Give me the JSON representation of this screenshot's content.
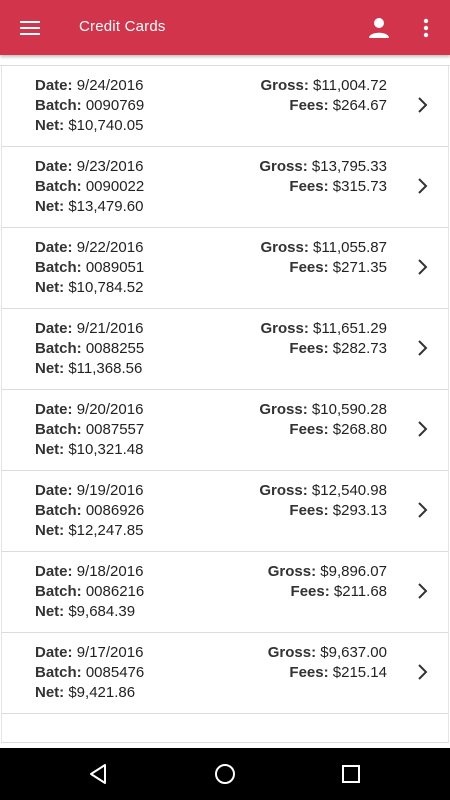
{
  "app_bar": {
    "title": "Credit Cards",
    "menu_icon": "hamburger-menu-icon",
    "account_icon": "account-icon",
    "more_icon": "more-vert-icon",
    "color": "#d2344b"
  },
  "labels": {
    "date": "Date:",
    "batch": "Batch:",
    "net": "Net:",
    "gross": "Gross:",
    "fees": "Fees:"
  },
  "batches": [
    {
      "date": "9/24/2016",
      "batch": "0090769",
      "net": "$10,740.05",
      "gross": "$11,004.72",
      "fees": "$264.67"
    },
    {
      "date": "9/23/2016",
      "batch": "0090022",
      "net": "$13,479.60",
      "gross": "$13,795.33",
      "fees": "$315.73"
    },
    {
      "date": "9/22/2016",
      "batch": "0089051",
      "net": "$10,784.52",
      "gross": "$11,055.87",
      "fees": "$271.35"
    },
    {
      "date": "9/21/2016",
      "batch": "0088255",
      "net": "$11,368.56",
      "gross": "$11,651.29",
      "fees": "$282.73"
    },
    {
      "date": "9/20/2016",
      "batch": "0087557",
      "net": "$10,321.48",
      "gross": "$10,590.28",
      "fees": "$268.80"
    },
    {
      "date": "9/19/2016",
      "batch": "0086926",
      "net": "$12,247.85",
      "gross": "$12,540.98",
      "fees": "$293.13"
    },
    {
      "date": "9/18/2016",
      "batch": "0086216",
      "net": "$9,684.39",
      "gross": "$9,896.07",
      "fees": "$211.68"
    },
    {
      "date": "9/17/2016",
      "batch": "0085476",
      "net": "$9,421.86",
      "gross": "$9,637.00",
      "fees": "$215.14"
    }
  ],
  "nav_bar": {
    "back_icon": "back-triangle-icon",
    "home_icon": "home-circle-icon",
    "recents_icon": "recents-square-icon"
  }
}
